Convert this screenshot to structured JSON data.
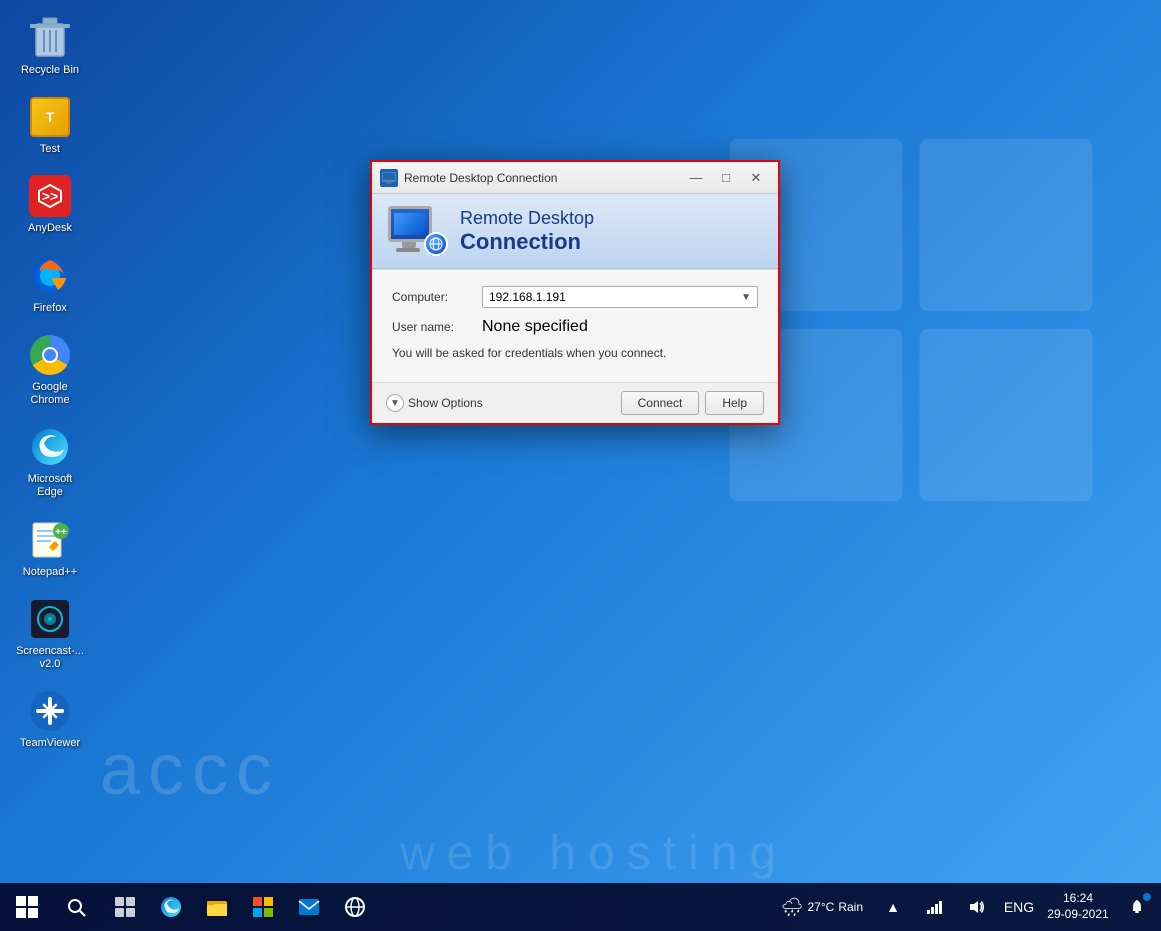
{
  "desktop": {
    "background": "Windows 10 blue gradient desktop",
    "watermark_text1": "accc",
    "watermark_text2": "web hosting"
  },
  "icons": [
    {
      "id": "recycle-bin",
      "label": "Recycle Bin",
      "type": "recycle"
    },
    {
      "id": "test",
      "label": "Test",
      "type": "test"
    },
    {
      "id": "anydesk",
      "label": "AnyDesk",
      "type": "anydesk"
    },
    {
      "id": "firefox",
      "label": "Firefox",
      "type": "firefox"
    },
    {
      "id": "google-chrome",
      "label": "Google Chrome",
      "type": "chrome"
    },
    {
      "id": "microsoft-edge",
      "label": "Microsoft Edge",
      "type": "edge"
    },
    {
      "id": "notepadpp",
      "label": "Notepad++",
      "type": "notepad"
    },
    {
      "id": "screencast",
      "label": "Screencast-...\nv2.0",
      "type": "screencast"
    },
    {
      "id": "teamviewer",
      "label": "TeamViewer",
      "type": "teamviewer"
    }
  ],
  "rdc_dialog": {
    "title": "Remote Desktop Connection",
    "header_line1": "Remote Desktop",
    "header_line2": "Connection",
    "computer_label": "Computer:",
    "computer_value": "192.168.1.191",
    "username_label": "User name:",
    "username_value": "None specified",
    "info_text": "You will be asked for credentials when you connect.",
    "show_options_label": "Show Options",
    "connect_button": "Connect",
    "help_button": "Help"
  },
  "taskbar": {
    "start_icon": "⊞",
    "search_icon": "○",
    "task_view_icon": "⧉",
    "edge_icon": "e",
    "explorer_icon": "📁",
    "store_icon": "🛍",
    "mail_icon": "✉",
    "other_icon": "🌐",
    "weather_temp": "27°C",
    "weather_condition": "Rain",
    "time": "16:24",
    "date": "29-09-2021",
    "language": "ENG"
  }
}
